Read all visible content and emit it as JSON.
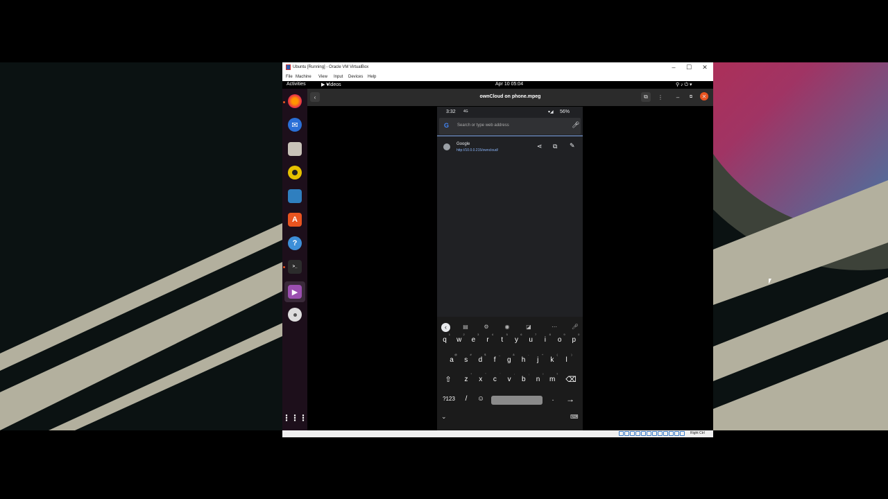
{
  "virtualbox": {
    "title": "Ubuntu [Running] - Oracle VM VirtualBox",
    "menu": [
      "File",
      "Machine",
      "View",
      "Input",
      "Devices",
      "Help"
    ],
    "host_key": "Right Ctrl"
  },
  "gnome": {
    "activities": "Activities",
    "app_menu": "Videos",
    "clock": "Apr 10  05:04"
  },
  "dock": [
    "firefox-icon",
    "thunderbird-icon",
    "files-icon",
    "rhythmbox-icon",
    "writer-icon",
    "software-icon",
    "help-icon",
    "terminal-icon",
    "videos-icon",
    "dvd-icon",
    "app-grid-icon"
  ],
  "player": {
    "title": "ownCloud on phone.mpeg"
  },
  "phone": {
    "time": "3:32",
    "network": "4G",
    "battery": "56%",
    "search_placeholder": "Search or type web address",
    "suggestion": {
      "title": "Google",
      "url": "http://10.0.0.215/owncloud/"
    },
    "keyboard": {
      "row1": [
        "q",
        "w",
        "e",
        "r",
        "t",
        "y",
        "u",
        "i",
        "o",
        "p"
      ],
      "row1_hints": [
        "1",
        "2",
        "3",
        "4",
        "5",
        "6",
        "7",
        "8",
        "9",
        "0"
      ],
      "row2": [
        "a",
        "s",
        "d",
        "f",
        "g",
        "h",
        "j",
        "k",
        "l"
      ],
      "row2_hints": [
        "@",
        "#",
        "$",
        "_",
        "&",
        "-",
        "+",
        "(",
        ")"
      ],
      "row3": [
        "z",
        "x",
        "c",
        "v",
        "b",
        "n",
        "m"
      ],
      "row3_hints": [
        "*",
        "\"",
        "'",
        ":",
        ";",
        "!",
        "?"
      ],
      "symbols_label": "?123",
      "slash": "/",
      "period": "."
    }
  },
  "colors": {
    "ubuntu_orange": "#e95420",
    "dock_bg": "#1d0f1b",
    "phone_bg": "#202124",
    "wallpaper_stripe": "#b3b09e"
  }
}
